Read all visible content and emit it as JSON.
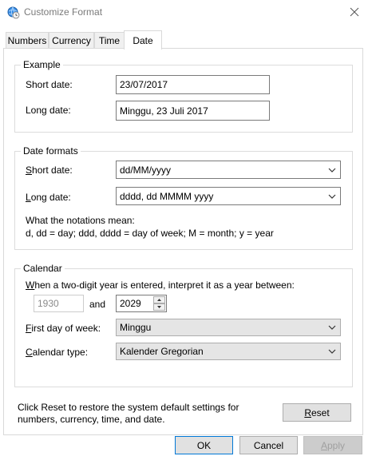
{
  "window": {
    "title": "Customize Format"
  },
  "tabs": [
    {
      "label": "Numbers"
    },
    {
      "label": "Currency"
    },
    {
      "label": "Time"
    },
    {
      "label": "Date",
      "active": true
    }
  ],
  "example": {
    "title": "Example",
    "short_label": "Short date:",
    "short_value": "23/07/2017",
    "long_label": "Long date:",
    "long_value": "Minggu, 23 Juli 2017"
  },
  "date_formats": {
    "title": "Date formats",
    "short_label_u": "S",
    "short_label_rest": "hort date:",
    "short_value": "dd/MM/yyyy",
    "long_label_u": "L",
    "long_label_rest": "ong date:",
    "long_value": "dddd, dd MMMM yyyy",
    "notation_title": "What the notations mean:",
    "notation_text": "d, dd = day;  ddd, dddd = day of week;  M = month;  y = year"
  },
  "calendar": {
    "title": "Calendar",
    "two_digit_label_pre": "W",
    "two_digit_label_rest": "hen a two-digit year is entered, interpret it as a year between:",
    "year_from": "1930",
    "and_label": "and",
    "year_to": "2029",
    "first_day_label_u": "F",
    "first_day_label_rest": "irst day of week:",
    "first_day_value": "Minggu",
    "type_label_u": "C",
    "type_label_rest": "alendar type:",
    "type_value": "Kalender Gregorian"
  },
  "reset": {
    "text": "Click Reset to restore the system default settings for numbers, currency, time, and date.",
    "button_u": "R",
    "button_rest": "eset"
  },
  "footer": {
    "ok": "OK",
    "cancel": "Cancel",
    "apply_u": "A",
    "apply_rest": "pply"
  }
}
